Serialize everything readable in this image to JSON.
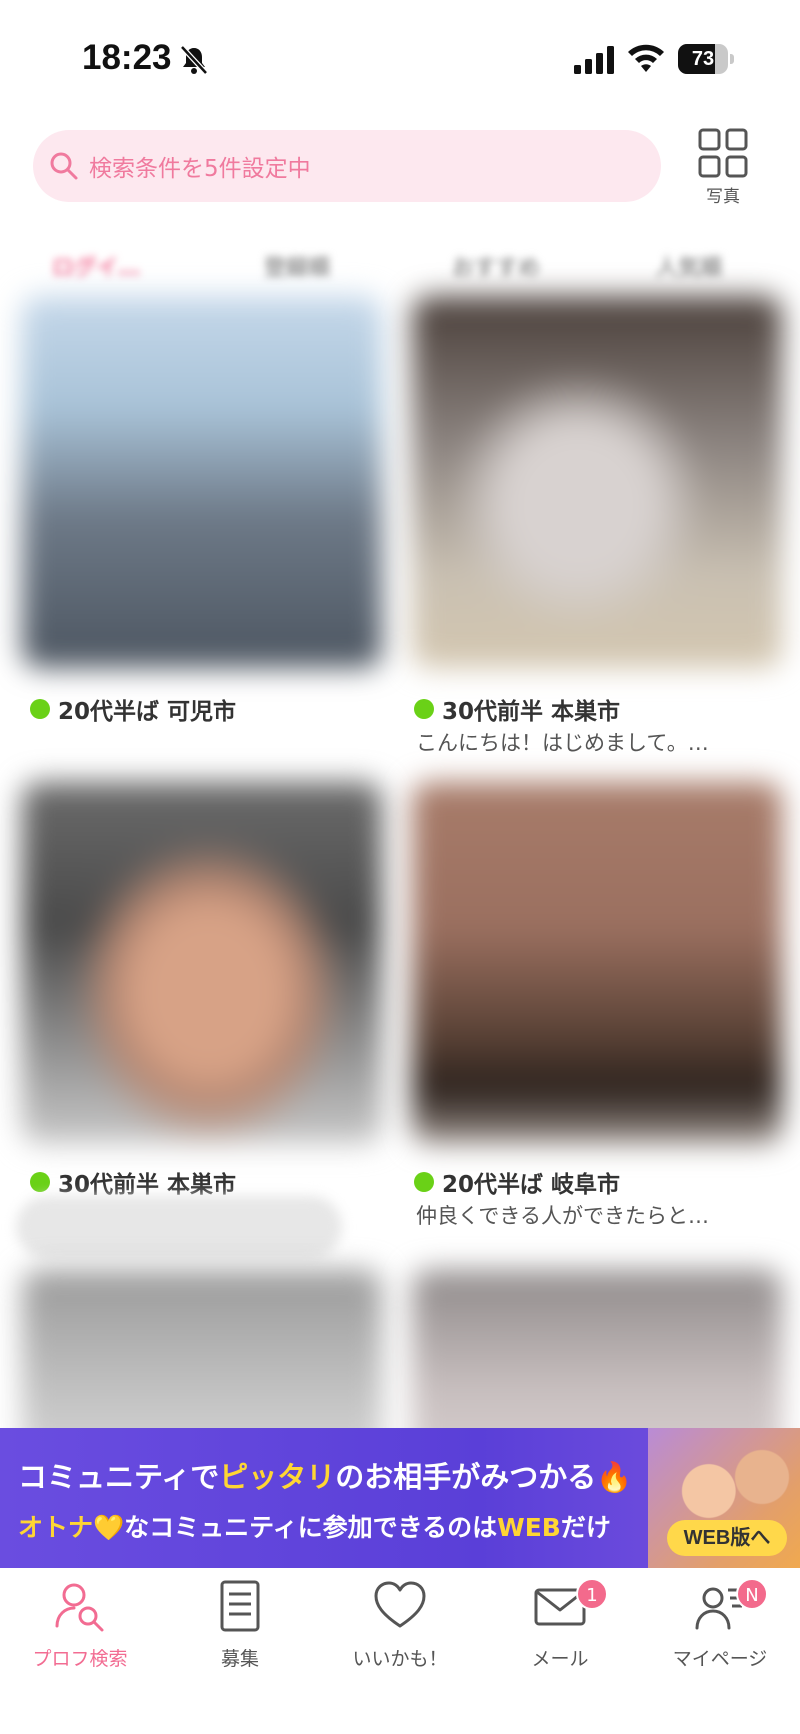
{
  "status_bar": {
    "time": "18:23",
    "battery": "73",
    "battery_level": 0.73
  },
  "search": {
    "text": "検索条件を5件設定中"
  },
  "view_toggle": {
    "label": "写真"
  },
  "tabs": [
    "ログイ…",
    "登録順",
    "おすすめ",
    "人気順"
  ],
  "profiles": [
    {
      "title": "20代半ば 可児市",
      "message": ""
    },
    {
      "title": "30代前半 本巣市",
      "message": "こんにちは！はじめまして。…"
    },
    {
      "title": "30代前半 本巣市",
      "message": ""
    },
    {
      "title": "20代半ば 岐阜市",
      "message": "仲良くできる人ができたらと…"
    }
  ],
  "banner": {
    "line1_a": "コミュニティで",
    "line1_b": "ピッタリ",
    "line1_c": "のお相手がみつかる🔥",
    "line2_a": "オトナ",
    "line2_b": "💛なコミュニティに参加できるのは",
    "line2_c": "WEB",
    "line2_d": "だけ",
    "button": "WEB版へ"
  },
  "nav": [
    {
      "label": "プロフ検索",
      "icon": "profile-search-icon",
      "active": true
    },
    {
      "label": "募集",
      "icon": "document-icon"
    },
    {
      "label": "いいかも！",
      "icon": "heart-icon"
    },
    {
      "label": "メール",
      "icon": "mail-icon",
      "badge": "1"
    },
    {
      "label": "マイページ",
      "icon": "person-list-icon",
      "badge": "N"
    }
  ],
  "colors": {
    "accent": "#f26c92",
    "online": "#6ad117",
    "banner": "#5a3fd8",
    "highlight": "#ffd633"
  }
}
